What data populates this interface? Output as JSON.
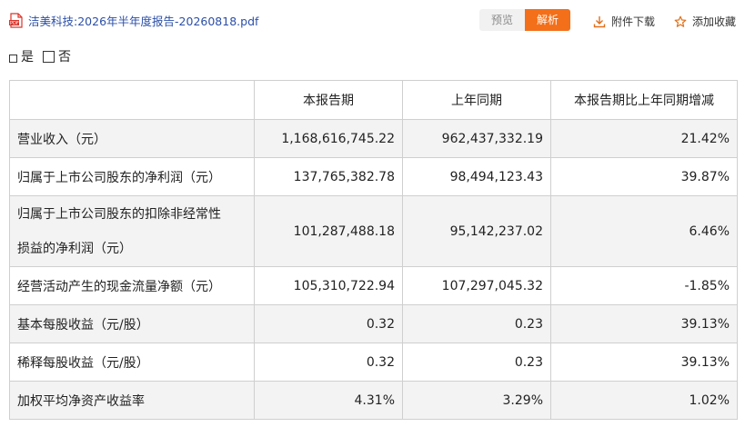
{
  "file": {
    "name": "洁美科技:2026年半年度报告-20260818.pdf"
  },
  "toolbar": {
    "preview_label": "预览",
    "parse_label": "解析",
    "download_label": "附件下载",
    "favorite_label": "添加收藏"
  },
  "options": {
    "yes_label": "是",
    "no_label": "否"
  },
  "table": {
    "headers": [
      "",
      "本报告期",
      "上年同期",
      "本报告期比上年同期增减"
    ],
    "rows": [
      {
        "label": "营业收入（元）",
        "current": "1,168,616,745.22",
        "prior": "962,437,332.19",
        "change": "21.42%"
      },
      {
        "label": "归属于上市公司股东的净利润（元）",
        "current": "137,765,382.78",
        "prior": "98,494,123.43",
        "change": "39.87%"
      },
      {
        "label_line1": "归属于上市公司股东的扣除非经常性",
        "label_line2": "损益的净利润（元）",
        "current": "101,287,488.18",
        "prior": "95,142,237.02",
        "change": "6.46%"
      },
      {
        "label": "经营活动产生的现金流量净额（元）",
        "current": "105,310,722.94",
        "prior": "107,297,045.32",
        "change": "-1.85%"
      },
      {
        "label": "基本每股收益（元/股）",
        "current": "0.32",
        "prior": "0.23",
        "change": "39.13%"
      },
      {
        "label": "稀释每股收益（元/股）",
        "current": "0.32",
        "prior": "0.23",
        "change": "39.13%"
      },
      {
        "label": "加权平均净资产收益率",
        "current": "4.31%",
        "prior": "3.29%",
        "change": "1.02%"
      }
    ]
  },
  "colors": {
    "accent": "#f36f19",
    "link": "#2b4fa8",
    "pdf_red": "#d9352b"
  }
}
